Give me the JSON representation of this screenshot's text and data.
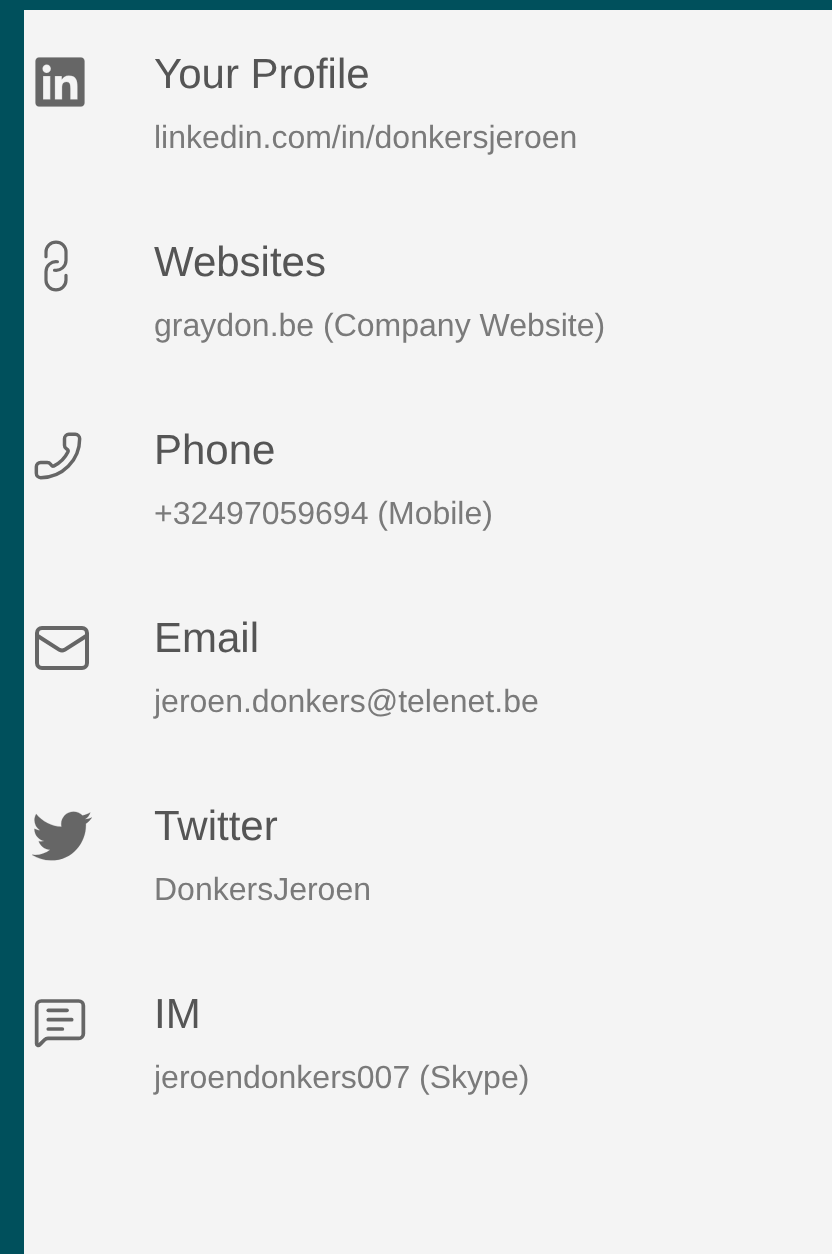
{
  "contacts": [
    {
      "kind": "linkedin",
      "label": "Your Profile",
      "value": "linkedin.com/in/donkersjeroen"
    },
    {
      "kind": "link",
      "label": "Websites",
      "value": "graydon.be (Company Website)"
    },
    {
      "kind": "phone",
      "label": "Phone",
      "value": "+32497059694 (Mobile)"
    },
    {
      "kind": "email",
      "label": "Email",
      "value": "jeroen.donkers@telenet.be"
    },
    {
      "kind": "twitter",
      "label": "Twitter",
      "value": "DonkersJeroen"
    },
    {
      "kind": "im",
      "label": "IM",
      "value": "jeroendonkers007 (Skype)"
    }
  ]
}
